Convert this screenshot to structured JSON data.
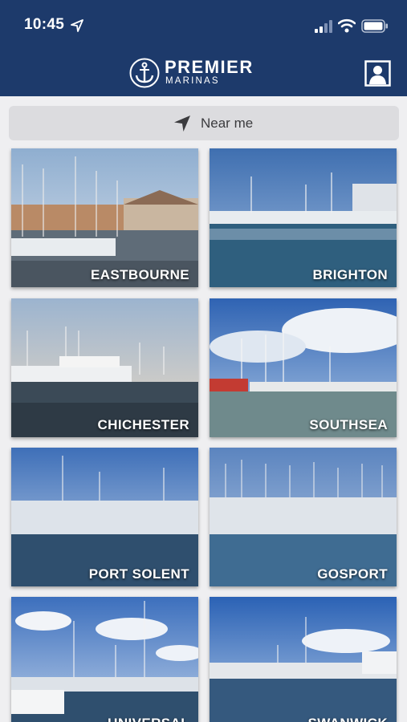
{
  "status_bar": {
    "time": "10:45"
  },
  "header": {
    "brand": "PREMIER",
    "brand_sub": "MARINAS"
  },
  "near_me": {
    "label": "Near me"
  },
  "marinas": [
    {
      "name": "EASTBOURNE"
    },
    {
      "name": "BRIGHTON"
    },
    {
      "name": "CHICHESTER"
    },
    {
      "name": "SOUTHSEA"
    },
    {
      "name": "PORT SOLENT"
    },
    {
      "name": "GOSPORT"
    },
    {
      "name": "UNIVERSAL"
    },
    {
      "name": "SWANWICK"
    }
  ],
  "colors": {
    "brand_navy": "#1d3a6b",
    "near_me_bg": "#dcdcdf",
    "page_bg": "#efeff1"
  }
}
